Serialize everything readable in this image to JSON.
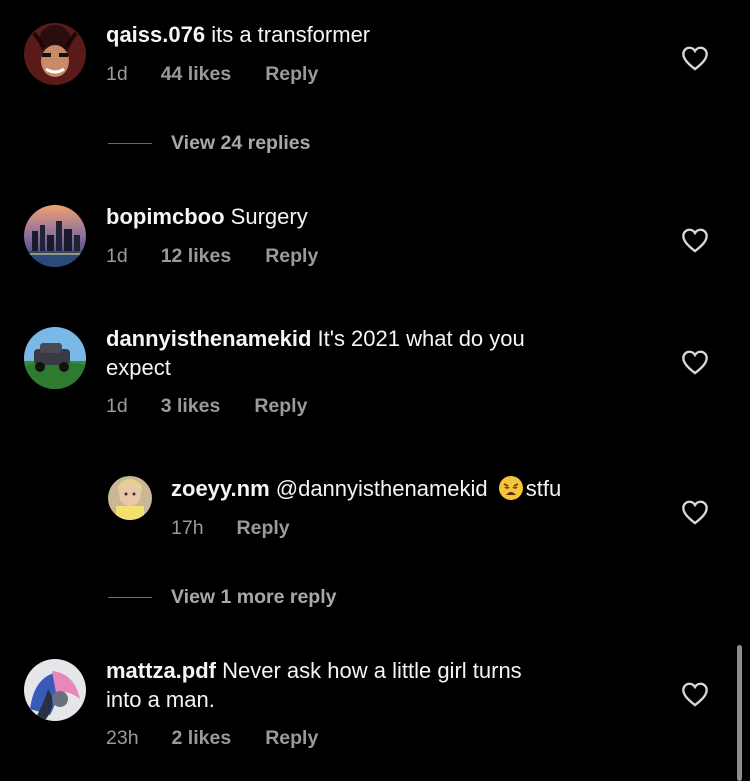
{
  "comments": [
    {
      "username": "qaiss.076",
      "text": "its a transformer",
      "time": "1d",
      "likes": "44 likes",
      "reply": "Reply",
      "view_replies": "View 24 replies"
    },
    {
      "username": "bopimcboo",
      "text": "Surgery",
      "time": "1d",
      "likes": "12 likes",
      "reply": "Reply"
    },
    {
      "username": "dannyisthenamekid",
      "text": "It's 2021 what do you",
      "text_line2": "expect",
      "time": "1d",
      "likes": "3 likes",
      "reply": "Reply",
      "replies": [
        {
          "username": "zoeyy.nm",
          "mention": "@dannyisthenamekid",
          "emoji": "weary-face",
          "text": "stfu",
          "time": "17h",
          "reply": "Reply"
        }
      ],
      "view_replies": "View 1 more reply"
    },
    {
      "username": "mattza.pdf",
      "text": "Never ask how a little girl turns",
      "text_line2": "into a man.",
      "time": "23h",
      "likes": "2 likes",
      "reply": "Reply"
    }
  ],
  "icons": {
    "like": "heart-outline-icon"
  },
  "colors": {
    "background": "#000000",
    "text": "#f5f5f5",
    "secondary": "#9a9a9a",
    "mention": "#e0f1ff"
  }
}
